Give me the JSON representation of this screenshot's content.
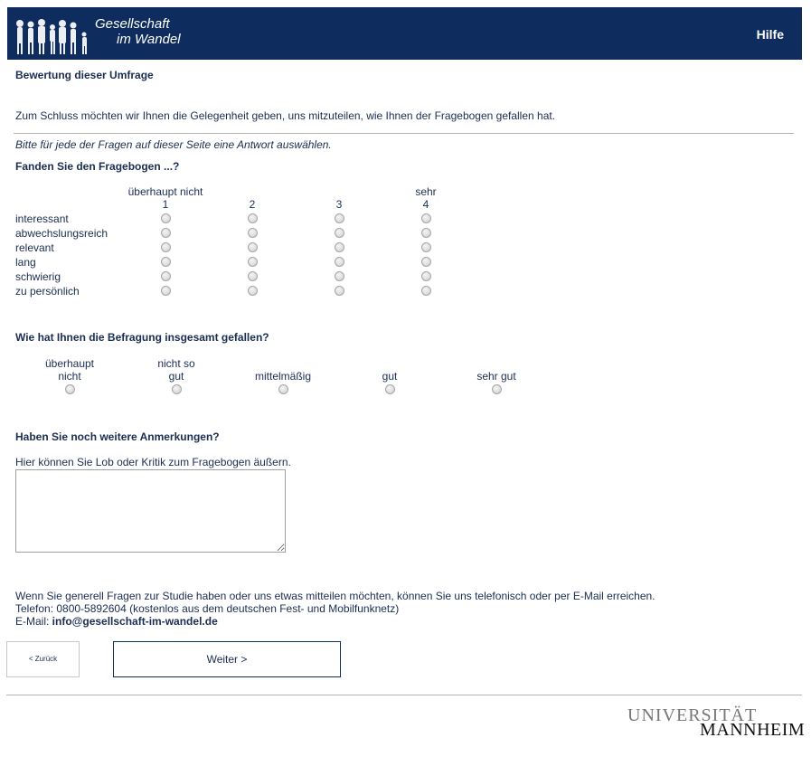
{
  "header": {
    "logo_line1": "Gesellschaft",
    "logo_line2": "im Wandel",
    "help_label": "Hilfe",
    "bg_color": "#0f2c5e"
  },
  "page_title": "Bewertung dieser Umfrage",
  "intro": "Zum Schluss möchten wir Ihnen die Gelegenheit geben, uns mitzuteilen, wie Ihnen der Fragebogen gefallen hat.",
  "instruction": "Bitte für jede der Fragen auf dieser Seite eine Antwort auswählen.",
  "q1": {
    "title": "Fanden Sie den Fragebogen ...?",
    "scale_low_label": "überhaupt nicht",
    "scale_high_label": "sehr",
    "scale_values": [
      "1",
      "2",
      "3",
      "4"
    ],
    "rows": [
      "interessant",
      "abwechslungsreich",
      "relevant",
      "lang",
      "schwierig",
      "zu persönlich"
    ]
  },
  "q2": {
    "title": "Wie hat Ihnen die Befragung insgesamt gefallen?",
    "options": [
      {
        "line1": "überhaupt",
        "line2": "nicht"
      },
      {
        "line1": "nicht so",
        "line2": "gut"
      },
      {
        "line1": "",
        "line2": "mittelmäßig"
      },
      {
        "line1": "",
        "line2": "gut"
      },
      {
        "line1": "",
        "line2": "sehr gut"
      }
    ]
  },
  "q3": {
    "title": "Haben Sie noch weitere Anmerkungen?",
    "hint": "Hier können Sie Lob oder Kritik zum Fragebogen äußern.",
    "value": ""
  },
  "contact": {
    "line1": "Wenn Sie generell Fragen zur Studie haben oder uns etwas mitteilen möchten, können Sie uns telefonisch oder per E-Mail erreichen.",
    "line2": "Telefon: 0800-5892604 (kostenlos aus dem deutschen Fest- und Mobilfunknetz)",
    "email_label": "E-Mail: ",
    "email": "info@gesellschaft-im-wandel.de"
  },
  "nav": {
    "back_label": "< Zurück",
    "next_label": "Weiter >"
  },
  "footer": {
    "logo_line1": "UNIVERSITÄT",
    "logo_line2": "MANNHEIM"
  }
}
